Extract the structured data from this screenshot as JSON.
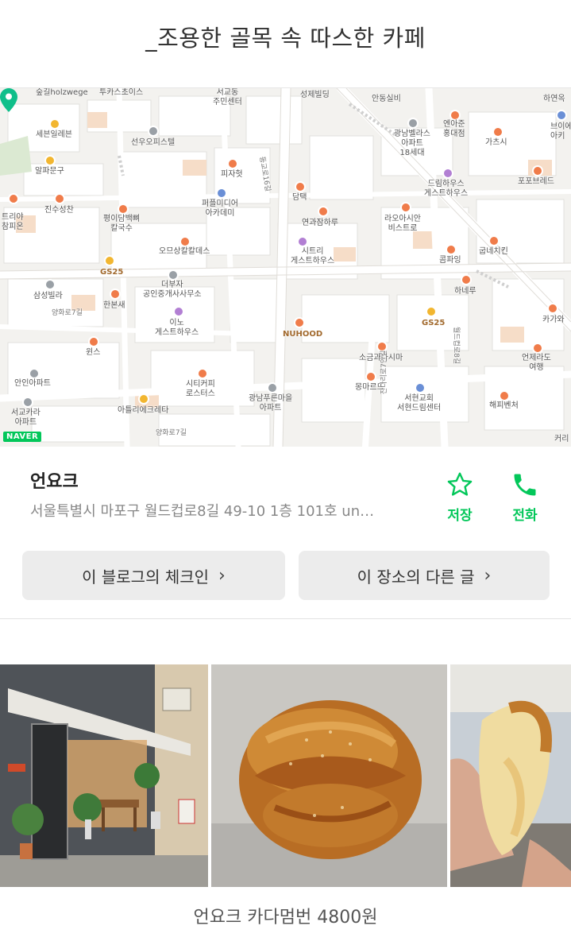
{
  "post": {
    "title": "_조용한 골목 속 따스한 카페"
  },
  "map": {
    "attribution": "NAVER",
    "labels": [
      {
        "text": "숲길holzwege"
      },
      {
        "text": "투카스초이스"
      },
      {
        "text": "서교동\n주민센터"
      },
      {
        "text": "성제빌딩"
      },
      {
        "text": "안동실비"
      },
      {
        "text": "하연옥"
      },
      {
        "text": "세븐일레븐"
      },
      {
        "text": "선우오피스텔"
      },
      {
        "text": "엔아준\n홍대점"
      },
      {
        "text": "광남벨라스\n아파트\n18세대"
      },
      {
        "text": "가츠시"
      },
      {
        "text": "브이에\n아키"
      },
      {
        "text": "알파문구"
      },
      {
        "text": "피자헛"
      },
      {
        "text": "포포브레드"
      },
      {
        "text": "퍼플미디어\n아카데미"
      },
      {
        "text": "담택"
      },
      {
        "text": "드림하우스\n게스트하우스"
      },
      {
        "text": "트리야\n참피온"
      },
      {
        "text": "진수성찬"
      },
      {
        "text": "평이담백뼈\n칼국수"
      },
      {
        "text": "연과잠하루"
      },
      {
        "text": "라오아시안\n비스트로"
      },
      {
        "text": "오므상칼칼데스"
      },
      {
        "text": "GS25"
      },
      {
        "text": "시트리\n게스트하우스"
      },
      {
        "text": "굽네치킨"
      },
      {
        "text": "콤파잉"
      },
      {
        "text": "더부자\n공인중개사사무소"
      },
      {
        "text": "삼성빌라"
      },
      {
        "text": "한본새"
      },
      {
        "text": "하네루"
      },
      {
        "text": "양화로7길"
      },
      {
        "text": "이노\n게스트하우스"
      },
      {
        "text": "NUHOOD"
      },
      {
        "text": "GS25"
      },
      {
        "text": "카가와"
      },
      {
        "text": "윈스"
      },
      {
        "text": "소금과다시마"
      },
      {
        "text": "언제라도\n여행"
      },
      {
        "text": "안인아파트"
      },
      {
        "text": "시티커피\n로스터스"
      },
      {
        "text": "몽마르뜨"
      },
      {
        "text": "광남푸른마을\n아파트"
      },
      {
        "text": "서현교회\n서현드림센터"
      },
      {
        "text": "해피벤처"
      },
      {
        "text": "서교카라\n아파트"
      },
      {
        "text": "아틀리에크레타"
      },
      {
        "text": "양화로7길"
      },
      {
        "text": "동교로16길"
      },
      {
        "text": "월드컵로8길"
      },
      {
        "text": "잔다리로7안길"
      },
      {
        "text": "커리"
      }
    ]
  },
  "place": {
    "name": "언요크",
    "address": "서울특별시 마포구 월드컵로8길 49-10 1층 101호 un…",
    "save_label": "저장",
    "call_label": "전화",
    "brand_color": "#03c75a"
  },
  "buttons": {
    "checkin_label": "이 블로그의 체크인",
    "other_posts_label": "이 장소의 다른 글"
  },
  "photos": {
    "caption": "언요크 카다멈번 4800원"
  }
}
